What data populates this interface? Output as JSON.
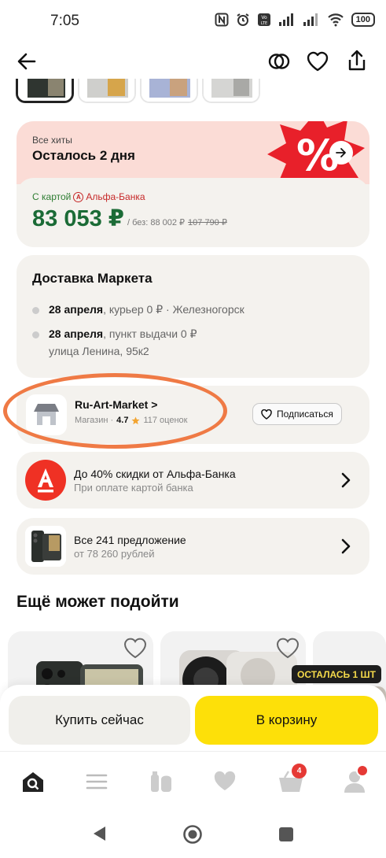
{
  "status_bar": {
    "time": "7:05",
    "battery": "100"
  },
  "promo": {
    "subtitle": "Все хиты",
    "title": "Осталось 2 дня",
    "card_prefix": "С картой",
    "bank_name": "Альфа-Банка",
    "price": "83 053 ₽",
    "price_without": "/ без: 88 002 ₽",
    "price_old": "107 790 ₽"
  },
  "delivery": {
    "title": "Доставка Маркета",
    "rows": [
      {
        "date": "28 апреля",
        "text": ", курьер 0 ₽ · Железногорск"
      },
      {
        "date": "28 апреля",
        "text": ", пункт выдачи 0 ₽"
      }
    ],
    "address": "улица Ленина, 95к2"
  },
  "shop": {
    "name": "Ru-Art-Market",
    "chevron": ">",
    "type": "Магазин ·",
    "rating": "4.7",
    "reviews": "117 оценок",
    "subscribe_label": "Подписаться"
  },
  "alfa_offer": {
    "icon_letter": "A",
    "title": "До 40% скидки от Альфа-Банка",
    "subtitle": "При оплате картой банка"
  },
  "offers": {
    "title": "Все 241 предложение",
    "subtitle": "от 78 260 рублей"
  },
  "recommendations": {
    "title": "Ещё может подойти",
    "badge": "ОСТАЛАСЬ 1 ШТ"
  },
  "actions": {
    "buy_now": "Купить сейчас",
    "add_to_cart": "В корзину"
  },
  "nav": {
    "cart_count": "4"
  },
  "colors": {
    "accent_yellow": "#fde009",
    "price_green": "#1b6b36",
    "alfa_red": "#e53935",
    "highlight": "#ef7a45",
    "promo_pink": "#fbdcd6",
    "card_bg": "#f4f2ee"
  }
}
